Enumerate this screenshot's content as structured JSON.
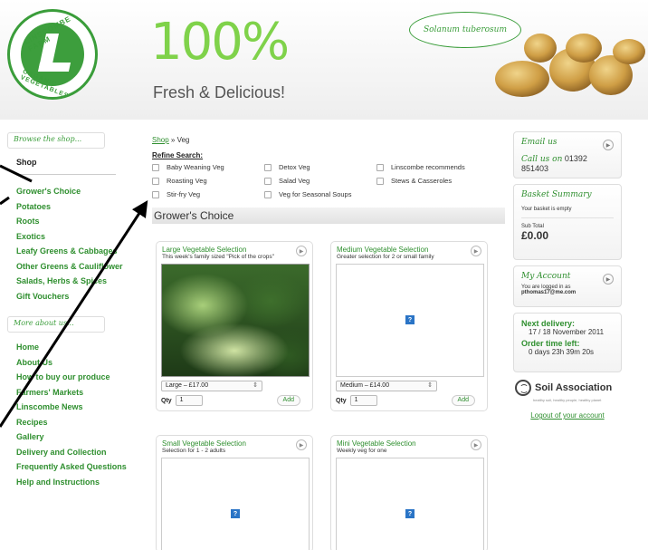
{
  "header": {
    "logo_top": "LINSCOMBE FARM",
    "logo_bottom": "ORGANIC VEGETABLES",
    "hero_big": "100%",
    "hero_sub": "Fresh & Delicious!",
    "latin": "Solanum tuberosum"
  },
  "sidebar": {
    "search_placeholder": "Browse the shop...",
    "shop_heading": "Shop",
    "shop_items": [
      "Grower's Choice",
      "Potatoes",
      "Roots",
      "Exotics",
      "Leafy Greens & Cabbages",
      "Other Greens & Cauliflower",
      "Salads, Herbs & Spices",
      "Gift Vouchers"
    ],
    "about_placeholder": "More about us...",
    "about_items": [
      "Home",
      "About Us",
      "How to buy our produce",
      "Farmers' Markets",
      "Linscombe News",
      "Recipes",
      "Gallery",
      "Delivery and Collection",
      "Frequently Asked Questions",
      "Help and Instructions"
    ]
  },
  "main": {
    "breadcrumb_link": "Shop",
    "breadcrumb_current": " » Veg",
    "refine_label": "Refine Search:",
    "filters": [
      "Baby Weaning Veg",
      "Detox Veg",
      "Linscombe recommends",
      "Roasting Veg",
      "Salad Veg",
      "Stews & Casseroles",
      "Stir-fry Veg",
      "Veg for Seasonal Soups"
    ],
    "section_title": "Grower's Choice",
    "products": [
      {
        "title": "Large Vegetable Selection",
        "subtitle": "This week's family sized \"Pick of the crops\"",
        "option": "Large – £17.00",
        "qty": "1",
        "add": "Add"
      },
      {
        "title": "Medium Vegetable Selection",
        "subtitle": "Greater selection for 2 or small family",
        "option": "Medium – £14.00",
        "qty": "1",
        "add": "Add"
      },
      {
        "title": "Small Vegetable Selection",
        "subtitle": "Selection for 1 - 2 adults"
      },
      {
        "title": "Mini Vegetable Selection",
        "subtitle": "Weekly veg for one"
      }
    ],
    "qty_label": "Qty",
    "placeholder_icon": "?"
  },
  "right": {
    "email_label": "Email us",
    "call_label": "Call us on",
    "phone": "01392 851403",
    "basket_title": "Basket Summary",
    "basket_empty": "Your basket is empty",
    "subtotal_label": "Sub Total",
    "subtotal_value": "£0.00",
    "account_title": "My Account",
    "logged_in_text": "You are logged in as",
    "account_email": "pthomas17@me.com",
    "next_delivery_label": "Next delivery:",
    "next_delivery_value": "17 / 18 November 2011",
    "order_time_label": "Order time left:",
    "order_time_value": "0 days 23h 39m 20s",
    "soil_name": "Soil Association",
    "soil_tagline": "healthy soil, healthy people, healthy planet",
    "logout": "Logout of your account"
  },
  "colors": {
    "brand_green": "#2f8f2f",
    "hero_green": "#7fd24a"
  }
}
